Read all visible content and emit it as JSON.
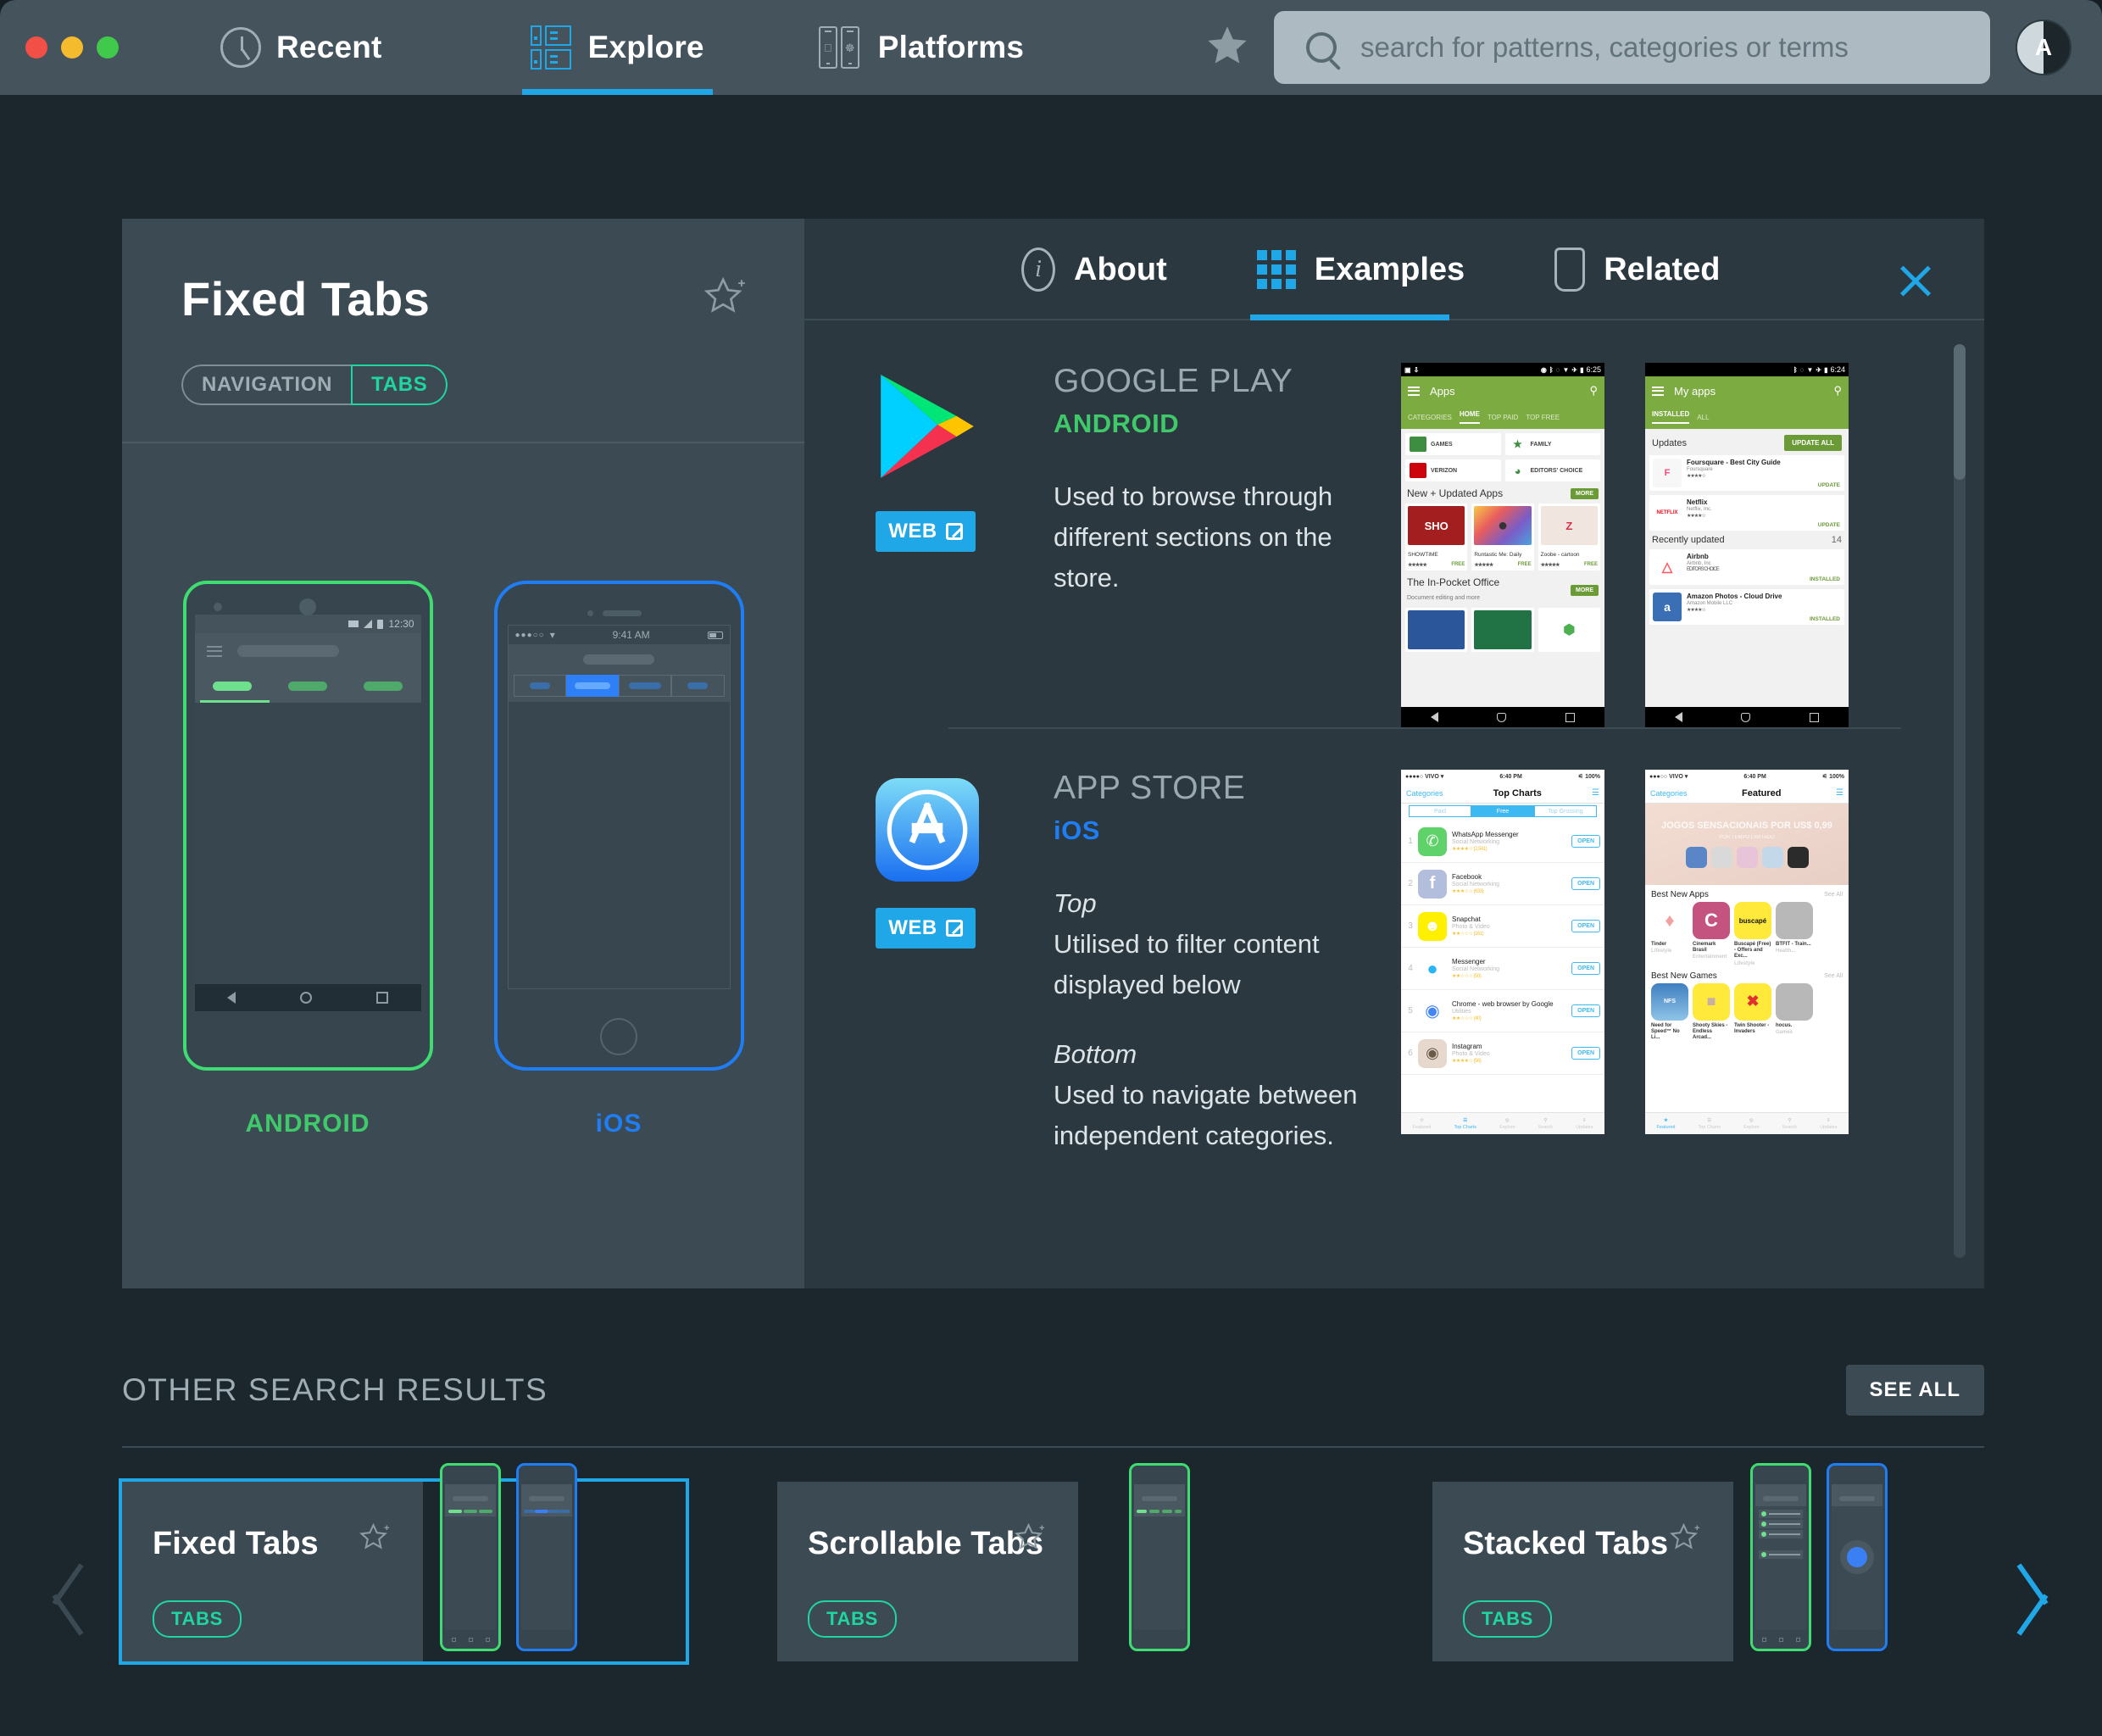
{
  "window": {
    "traffic_lights": [
      "close",
      "minimize",
      "maximize"
    ]
  },
  "topnav": {
    "items": [
      {
        "label": "Recent",
        "icon": "clock-icon",
        "active": false
      },
      {
        "label": "Explore",
        "icon": "explore-grid-icon",
        "active": true
      },
      {
        "label": "Platforms",
        "icon": "platforms-devices-icon",
        "active": false
      }
    ],
    "favorites_icon": "star-filled-icon",
    "search": {
      "placeholder": "search for patterns, categories or terms",
      "value": "",
      "icon": "search-icon"
    },
    "avatar": {
      "initial": "A",
      "name": "avatar"
    }
  },
  "detail": {
    "title": "Fixed Tabs",
    "favorite_icon": "star-plus-icon",
    "chips": [
      {
        "label": "NAVIGATION",
        "tone": "muted"
      },
      {
        "label": "TABS",
        "tone": "accent"
      }
    ],
    "mockups": [
      {
        "platform_label": "ANDROID",
        "color": "#3fc96a",
        "status_time": "12:30"
      },
      {
        "platform_label": "iOS",
        "color": "#1f7ef5",
        "status_time": "9:41 AM"
      }
    ],
    "tabs": [
      {
        "label": "About",
        "icon": "info-icon",
        "active": false
      },
      {
        "label": "Examples",
        "icon": "grid-icon",
        "active": true
      },
      {
        "label": "Related",
        "icon": "card-icon",
        "active": false
      }
    ],
    "close_label": "close-icon"
  },
  "examples": [
    {
      "logo": "google-play-icon",
      "name": "GOOGLE PLAY",
      "platform": "ANDROID",
      "platform_color": "#3fc96a",
      "web_button": "WEB",
      "description_lines": [
        {
          "style": "normal",
          "text": "Used to browse through"
        },
        {
          "style": "normal",
          "text": "different sections on the"
        },
        {
          "style": "normal",
          "text": "store."
        }
      ],
      "shots": [
        {
          "status_time": "6:25",
          "app_title": "Apps",
          "tabs": [
            "CATEGORIES",
            "HOME",
            "TOP PAID",
            "TOP FREE"
          ],
          "active_tab": "HOME",
          "categories": [
            "GAMES",
            "FAMILY",
            "VERIZON",
            "EDITORS' CHOICE"
          ],
          "section_1": {
            "title": "New + Updated Apps",
            "more": "MORE"
          },
          "apps": [
            {
              "name": "SHOWTIME",
              "badge": "SHO",
              "price": "FREE",
              "color": "#a31f1f"
            },
            {
              "name": "Runtastic Me: Daily",
              "badge": "",
              "price": "FREE",
              "color": "#e8e8e8"
            },
            {
              "name": "Zoobe - cartoon",
              "badge": "Z",
              "price": "FREE",
              "color": "#f0e6df"
            }
          ],
          "section_2": {
            "title": "The In-Pocket Office",
            "subtitle": "Document editing and more",
            "more": "MORE"
          }
        },
        {
          "status_time": "6:24",
          "app_title": "My apps",
          "tabs": [
            "INSTALLED",
            "ALL"
          ],
          "active_tab": "INSTALLED",
          "updates_header": "Updates",
          "update_all": "UPDATE ALL",
          "rows": [
            {
              "title": "Foursquare - Best City Guide",
              "sub": "Foursquare",
              "stars": "★★★★☆",
              "action": "UPDATE",
              "badge": "F",
              "color": "#f4f4f4"
            },
            {
              "title": "Netflix",
              "sub": "Netflix, Inc.",
              "stars": "★★★★☆",
              "action": "UPDATE",
              "badge": "NETFLIX",
              "color": "#ffffff"
            }
          ],
          "recent_header": "Recently updated",
          "recent_count": "14",
          "recent_rows": [
            {
              "title": "Airbnb",
              "sub": "Airbnb, Inc",
              "extra": "EDITORS' CHOICE",
              "action": "INSTALLED",
              "badge": "A",
              "color": "#ffffff"
            },
            {
              "title": "Amazon Photos - Cloud Drive",
              "sub": "Amazon Mobile LLC",
              "stars": "★★★★☆",
              "action": "INSTALLED",
              "badge": "a",
              "color": "#3a6fb5"
            }
          ]
        }
      ]
    },
    {
      "logo": "app-store-icon",
      "name": "APP STORE",
      "platform": "iOS",
      "platform_color": "#1f7ef5",
      "web_button": "WEB",
      "description_lines": [
        {
          "style": "italic",
          "text": "Top"
        },
        {
          "style": "normal",
          "text": "Utilised to filter content"
        },
        {
          "style": "normal",
          "text": "displayed below"
        },
        {
          "style": "gap",
          "text": ""
        },
        {
          "style": "italic",
          "text": "Bottom"
        },
        {
          "style": "normal",
          "text": "Used to navigate between"
        },
        {
          "style": "normal",
          "text": "independent categories."
        }
      ],
      "shots": [
        {
          "carrier": "VIVO",
          "status_time": "6:40 PM",
          "battery": "100%",
          "nav_left": "Categories",
          "nav_title": "Top Charts",
          "segments": [
            "Paid",
            "Free",
            "Top Grossing"
          ],
          "active_segment": "Free",
          "rows": [
            {
              "rank": "1",
              "name": "WhatsApp Messenger",
              "cat": "Social Networking",
              "rating": "★★★★☆ (2,541)",
              "action": "OPEN",
              "color": "#5fd36a"
            },
            {
              "rank": "2",
              "name": "Facebook",
              "cat": "Social Networking",
              "rating": "★★★☆☆ (633)",
              "action": "OPEN",
              "color": "#b3bedd"
            },
            {
              "rank": "3",
              "name": "Snapchat",
              "cat": "Photo & Video",
              "rating": "★★☆☆☆ (161)",
              "action": "OPEN",
              "color": "#fff000"
            },
            {
              "rank": "4",
              "name": "Messenger",
              "cat": "Social Networking",
              "rating": "★★☆☆☆ (50)",
              "action": "OPEN",
              "color": "#ffffff"
            },
            {
              "rank": "5",
              "name": "Chrome - web browser by Google",
              "cat": "Utilities",
              "rating": "★★☆☆☆ (40)",
              "action": "OPEN",
              "color": "#ffffff"
            },
            {
              "rank": "6",
              "name": "Instagram",
              "cat": "Photo & Video",
              "rating": "★★★★☆ (56)",
              "action": "OPEN",
              "color": "#e6d8cc"
            }
          ],
          "tabbar": [
            "Featured",
            "Top Charts",
            "Explore",
            "Search",
            "Updates"
          ],
          "active_tab": "Top Charts"
        },
        {
          "carrier": "VIVO",
          "status_time": "6:40 PM",
          "battery": "100%",
          "nav_left": "Categories",
          "nav_title": "Featured",
          "hero_title": "JOGOS SENSACIONAIS POR US$ 0,99",
          "hero_sub": "POR TEMPO LIMITADO",
          "sections": [
            {
              "title": "Best New Apps",
              "see_all": "See All",
              "apps": [
                {
                  "name": "Tinder",
                  "cat": "Lifestyle",
                  "color": "#ffffff"
                },
                {
                  "name": "Cinemark Brasil",
                  "cat": "Entertainment",
                  "color": "#c4547f"
                },
                {
                  "name": "Buscapé (Free) - Offers and Exc...",
                  "cat": "Lifestyle",
                  "color": "#ffe93b"
                },
                {
                  "name": "BTFIT - Train...",
                  "cat": "Health...",
                  "color": "#b8b8b8"
                }
              ]
            },
            {
              "title": "Best New Games",
              "see_all": "See All",
              "apps": [
                {
                  "name": "Need for Speed™ No Li...",
                  "cat": "",
                  "color": "#3f7fc0"
                },
                {
                  "name": "Shooty Skies - Endless Arcad...",
                  "cat": "",
                  "color": "#ffe93b"
                },
                {
                  "name": "Twin Shooter - Invaders",
                  "cat": "",
                  "color": "#ffe93b"
                },
                {
                  "name": "hocus.",
                  "cat": "Games",
                  "color": "#b8b8b8"
                }
              ]
            }
          ],
          "tabbar": [
            "Featured",
            "Top Charts",
            "Explore",
            "Search",
            "Updates"
          ],
          "active_tab": "Featured"
        }
      ]
    }
  ],
  "other_results": {
    "title": "OTHER SEARCH RESULTS",
    "see_all": "SEE ALL",
    "prev_icon": "chevron-left-icon",
    "next_icon": "chevron-right-icon",
    "cards": [
      {
        "title": "Fixed Tabs",
        "chip": "TABS",
        "selected": true,
        "previews": [
          "android",
          "ios"
        ]
      },
      {
        "title": "Scrollable Tabs",
        "chip": "TABS",
        "selected": false,
        "previews": [
          "android"
        ]
      },
      {
        "title": "Stacked Tabs",
        "chip": "TABS",
        "selected": false,
        "previews": [
          "android",
          "ios"
        ]
      }
    ]
  },
  "colors": {
    "accent_blue": "#1fa7e8",
    "accent_green": "#20d6a0",
    "android_green": "#3fc96a",
    "ios_blue": "#1f7ef5",
    "panel": "#3b4a53",
    "panel_dark": "#2b383f",
    "background": "#1b262d",
    "topbar": "#44535c"
  }
}
